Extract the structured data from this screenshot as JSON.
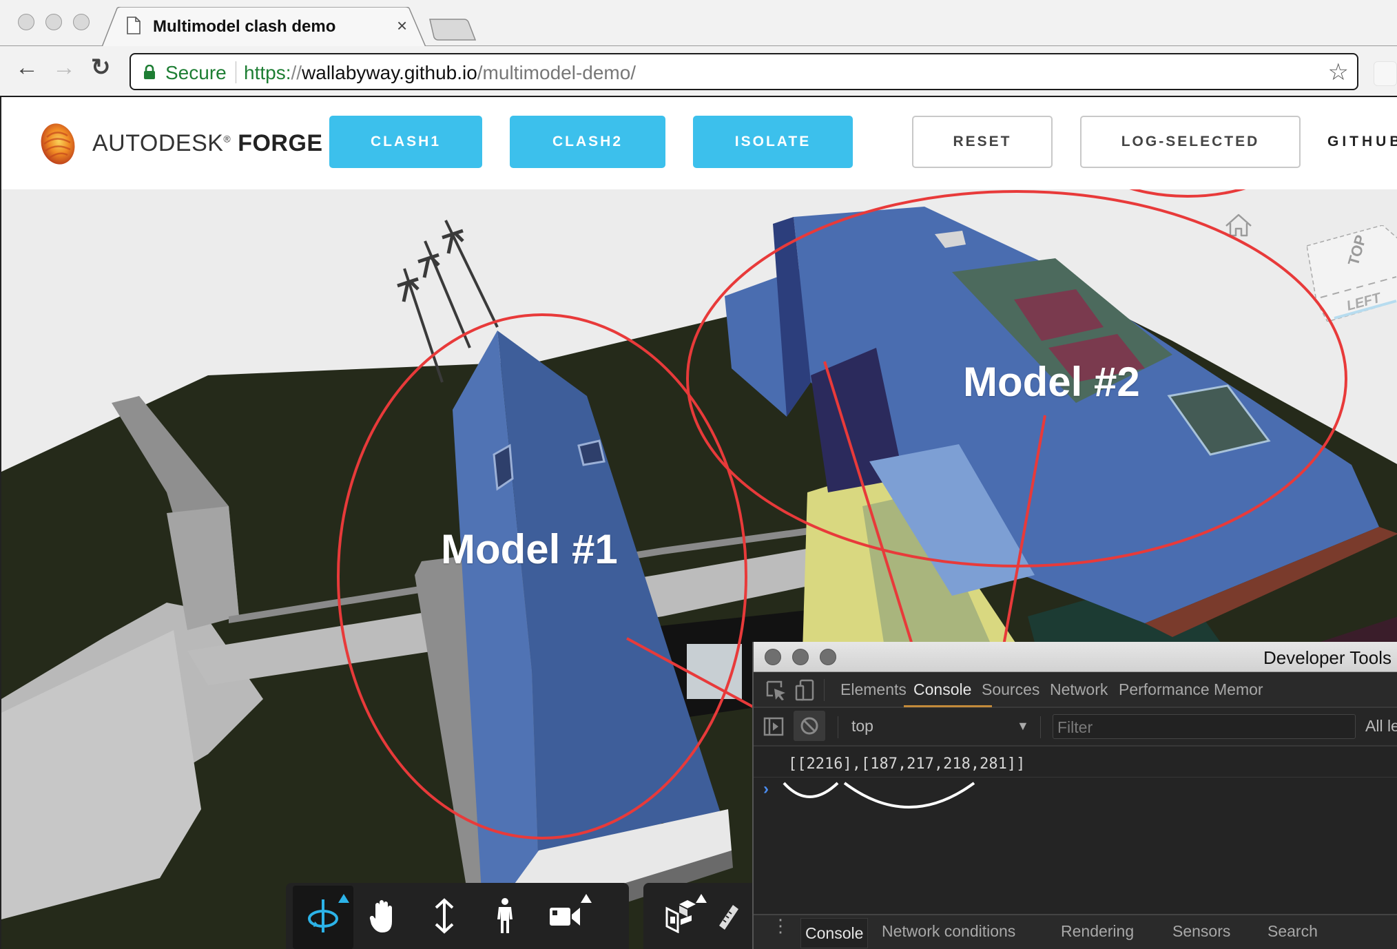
{
  "browser": {
    "tab_title": "Multimodel clash demo",
    "tab_close": "×",
    "secure_label": "Secure",
    "url": {
      "scheme": "https:",
      "slashes": "//",
      "host": "wallabyway.github.io",
      "path": "/multimodel-demo/"
    },
    "icons": {
      "back": "←",
      "forward": "→",
      "reload": "↻",
      "bookmark_star": "☆"
    }
  },
  "app": {
    "logo": {
      "brand": "AUTODESK",
      "trademark": "®",
      "product": "FORGE"
    },
    "buttons": {
      "clash1": "CLASH1",
      "clash2": "CLASH2",
      "isolate": "ISOLATE",
      "reset": "RESET",
      "log_selected": "LOG-SELECTED",
      "github": "GITHUB"
    },
    "colors": {
      "primary_button": "#3cc0ec",
      "annotation_red": "#e83a3a",
      "roof_blue": "#4a6db0"
    }
  },
  "viewer": {
    "annotations": {
      "model1": "Model #1",
      "model2": "Model #2"
    },
    "viewcube": {
      "top": "TOP",
      "left": "LEFT"
    },
    "toolbar": [
      {
        "name": "orbit",
        "active": true,
        "has_flyout": true
      },
      {
        "name": "pan",
        "active": false,
        "has_flyout": false
      },
      {
        "name": "zoom",
        "active": false,
        "has_flyout": false
      },
      {
        "name": "first-person",
        "active": false,
        "has_flyout": false
      },
      {
        "name": "camera",
        "active": false,
        "has_flyout": true
      },
      {
        "name": "explode-model",
        "active": false,
        "has_flyout": true
      },
      {
        "name": "measure",
        "active": false,
        "has_flyout": false
      }
    ]
  },
  "devtools": {
    "window_title": "Developer Tools",
    "tabs": [
      "Elements",
      "Console",
      "Sources",
      "Network",
      "Performance",
      "Memor"
    ],
    "active_tab": "Console",
    "context": "top",
    "filter_placeholder": "Filter",
    "levels": "All le",
    "log_output": "[[2216],[187,217,218,281]]",
    "prompt": "›",
    "drawer_tabs": [
      "Console",
      "Network conditions",
      "Rendering",
      "Sensors",
      "Search"
    ],
    "drawer_active": "Console"
  }
}
